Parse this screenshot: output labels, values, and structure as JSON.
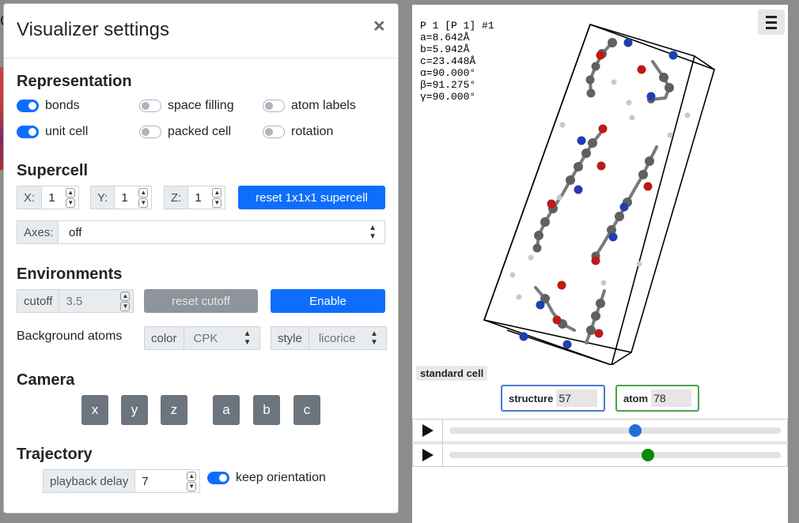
{
  "viewer": {
    "lattice_lines": [
      "P 1 [P 1] #1",
      "a=8.642Å",
      "b=5.942Å",
      "c=23.448Å",
      "α=90.000°",
      "β=91.275°",
      "γ=90.000°"
    ],
    "cell_label": "standard cell",
    "structure_label": "structure",
    "structure_index": "57",
    "atom_label": "atom",
    "atom_index": "78",
    "structure_slider_fraction": 0.56,
    "atom_slider_fraction": 0.6,
    "colors": {
      "structure": "#1f6fd6",
      "atom": "#0a8a0a"
    }
  },
  "modal": {
    "title": "Visualizer settings",
    "close": "×",
    "representation": {
      "title": "Representation",
      "toggles": [
        {
          "label": "bonds",
          "on": true
        },
        {
          "label": "space filling",
          "on": false
        },
        {
          "label": "atom labels",
          "on": false
        },
        {
          "label": "unit cell",
          "on": true
        },
        {
          "label": "packed cell",
          "on": false
        },
        {
          "label": "rotation",
          "on": false
        }
      ]
    },
    "supercell": {
      "title": "Supercell",
      "x_label": "X:",
      "x_value": "1",
      "y_label": "Y:",
      "y_value": "1",
      "z_label": "Z:",
      "z_value": "1",
      "reset_label": "reset 1x1x1 supercell",
      "axes_label": "Axes:",
      "axes_value": "off"
    },
    "environments": {
      "title": "Environments",
      "cutoff_label": "cutoff",
      "cutoff_value": "3.5",
      "reset_label": "reset cutoff",
      "enable_label": "Enable",
      "background_label": "Background atoms",
      "color_label": "color",
      "color_value": "CPK",
      "style_label": "style",
      "style_value": "licorice"
    },
    "camera": {
      "title": "Camera",
      "buttons": [
        "x",
        "y",
        "z",
        "a",
        "b",
        "c"
      ]
    },
    "trajectory": {
      "title": "Trajectory",
      "delay_label": "playback delay",
      "delay_value": "7",
      "keep_orientation_label": "keep orientation",
      "keep_orientation_on": true
    }
  }
}
